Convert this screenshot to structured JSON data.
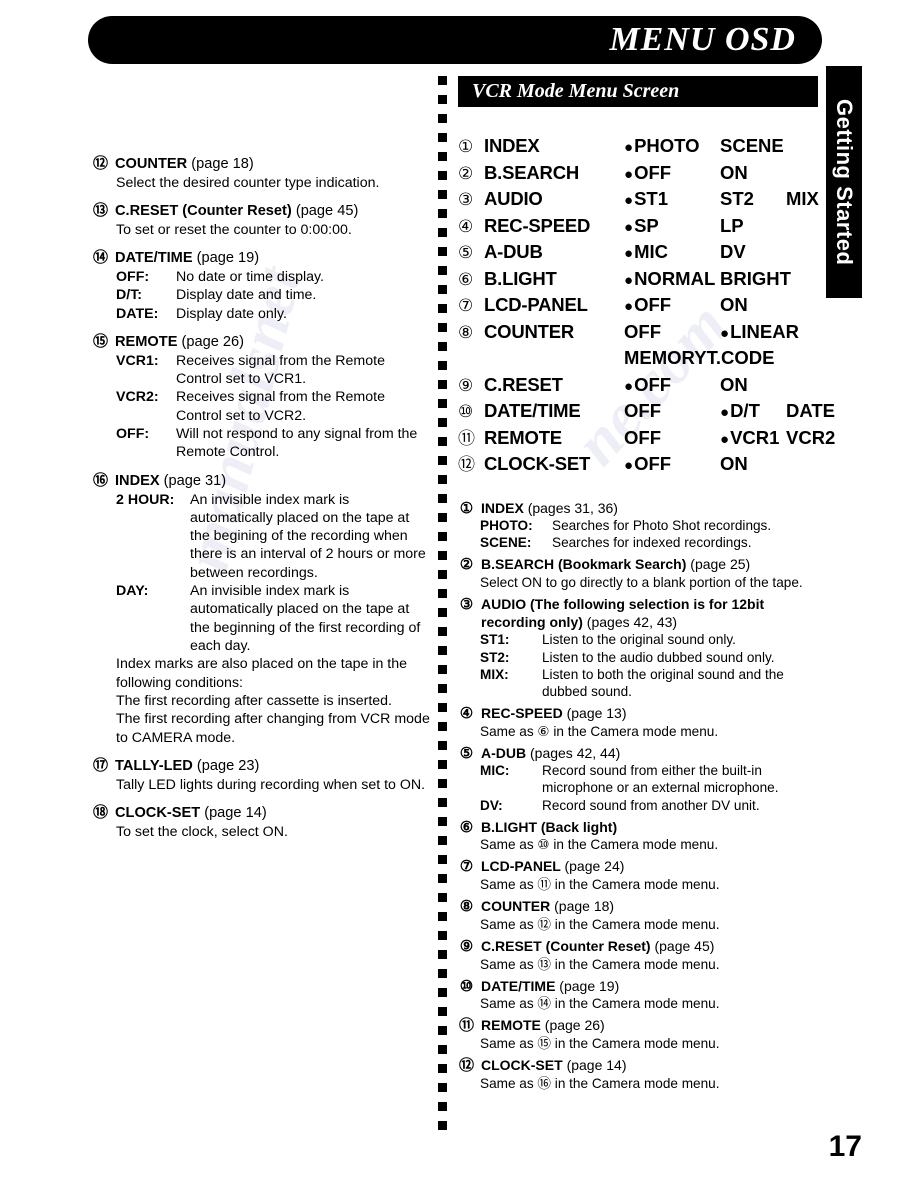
{
  "header": {
    "title": "MENU OSD",
    "side_tab": "Getting Started"
  },
  "page_number": "17",
  "left_column": {
    "entries": [
      {
        "num": "⑫",
        "label": "COUNTER",
        "page": "(page 18)",
        "desc": "Select the desired counter type indication."
      },
      {
        "num": "⑬",
        "label": "C.RESET (Counter Reset)",
        "page": "(page 45)",
        "desc": "To set or reset the counter to 0:00:00."
      },
      {
        "num": "⑭",
        "label": "DATE/TIME",
        "page": "(page 19)",
        "options": [
          {
            "key": "OFF:",
            "value": "No date or time display."
          },
          {
            "key": "D/T:",
            "value": "Display date and time."
          },
          {
            "key": "DATE:",
            "value": "Display date only."
          }
        ]
      },
      {
        "num": "⑮",
        "label": "REMOTE",
        "page": "(page 26)",
        "options": [
          {
            "key": "VCR1:",
            "value": "Receives signal from the Remote Control set to VCR1."
          },
          {
            "key": "VCR2:",
            "value": "Receives signal from the Remote Control set to VCR2."
          },
          {
            "key": "OFF:",
            "value": "Will not respond to any signal from the Remote Control."
          }
        ]
      },
      {
        "num": "⑯",
        "label": "INDEX",
        "page": "(page 31)",
        "options": [
          {
            "key": "2 HOUR:",
            "value": "An invisible index mark is automatically placed on the tape at the begining of the recording when there is an interval of 2 hours or more between recordings."
          },
          {
            "key": "DAY:",
            "value": "An invisible index mark is automatically placed on the tape at the beginning of the first recording of each day."
          }
        ],
        "extra": [
          "Index marks are also placed on the tape in the following conditions:",
          "The first recording after cassette is inserted.",
          "The first recording after changing from VCR mode to CAMERA mode."
        ]
      },
      {
        "num": "⑰",
        "label": "TALLY-LED",
        "page": "(page 23)",
        "desc": "Tally LED lights during recording when set to ON."
      },
      {
        "num": "⑱",
        "label": "CLOCK-SET",
        "page": "(page 14)",
        "desc": "To set the clock, select ON."
      }
    ]
  },
  "right_column": {
    "menu_screen_title": "VCR Mode Menu Screen",
    "osd_rows": [
      {
        "num": "①",
        "name": "INDEX",
        "opt1": "PHOTO",
        "opt1_selected": true,
        "opt2": "SCENE",
        "opt2_selected": false,
        "opt3": "",
        "opt3_selected": false
      },
      {
        "num": "②",
        "name": "B.SEARCH",
        "opt1": "OFF",
        "opt1_selected": true,
        "opt2": "ON",
        "opt2_selected": false,
        "opt3": "",
        "opt3_selected": false
      },
      {
        "num": "③",
        "name": "AUDIO",
        "opt1": "ST1",
        "opt1_selected": true,
        "opt2": "ST2",
        "opt2_selected": false,
        "opt3": "MIX",
        "opt3_selected": false
      },
      {
        "num": "④",
        "name": "REC-SPEED",
        "opt1": "SP",
        "opt1_selected": true,
        "opt2": "LP",
        "opt2_selected": false,
        "opt3": "",
        "opt3_selected": false
      },
      {
        "num": "⑤",
        "name": "A-DUB",
        "opt1": "MIC",
        "opt1_selected": true,
        "opt2": "DV",
        "opt2_selected": false,
        "opt3": "",
        "opt3_selected": false
      },
      {
        "num": "⑥",
        "name": "B.LIGHT",
        "opt1": "NORMAL",
        "opt1_selected": true,
        "opt2": "BRIGHT",
        "opt2_selected": false,
        "opt3": "",
        "opt3_selected": false
      },
      {
        "num": "⑦",
        "name": "LCD-PANEL",
        "opt1": "OFF",
        "opt1_selected": true,
        "opt2": "ON",
        "opt2_selected": false,
        "opt3": "",
        "opt3_selected": false
      },
      {
        "num": "⑧",
        "name": "COUNTER",
        "opt1": "OFF",
        "opt1_selected": false,
        "opt2": "LINEAR",
        "opt2_selected": true,
        "opt3": "",
        "opt3_selected": false,
        "sub1": "MEMORY",
        "sub1_selected": false,
        "sub2": "T.CODE",
        "sub2_selected": false
      },
      {
        "num": "⑨",
        "name": "C.RESET",
        "opt1": "OFF",
        "opt1_selected": true,
        "opt2": "ON",
        "opt2_selected": false,
        "opt3": "",
        "opt3_selected": false
      },
      {
        "num": "⑩",
        "name": "DATE/TIME",
        "opt1": "OFF",
        "opt1_selected": false,
        "opt2": "D/T",
        "opt2_selected": true,
        "opt3": "DATE",
        "opt3_selected": false
      },
      {
        "num": "⑪",
        "name": "REMOTE",
        "opt1": "OFF",
        "opt1_selected": false,
        "opt2": "VCR1",
        "opt2_selected": true,
        "opt3": "VCR2",
        "opt3_selected": false
      },
      {
        "num": "⑫",
        "name": "CLOCK-SET",
        "opt1": "OFF",
        "opt1_selected": true,
        "opt2": "ON",
        "opt2_selected": false,
        "opt3": "",
        "opt3_selected": false
      }
    ],
    "descriptions": [
      {
        "num": "①",
        "label": "INDEX",
        "page": "(pages 31, 36)",
        "options": [
          {
            "key": "PHOTO:",
            "value": "Searches for Photo Shot recordings."
          },
          {
            "key": "SCENE:",
            "value": "Searches for indexed recordings."
          }
        ]
      },
      {
        "num": "②",
        "label": "B.SEARCH (Bookmark Search)",
        "page": "(page 25)",
        "desc": "Select ON to go directly to a blank portion of the tape."
      },
      {
        "num": "③",
        "label": "AUDIO (The following selection is for 12bit recording only)",
        "page": "(pages 42, 43)",
        "options": [
          {
            "key": "ST1:",
            "value": "Listen to the original sound only."
          },
          {
            "key": "ST2:",
            "value": "Listen to the audio dubbed sound only."
          },
          {
            "key": "MIX:",
            "value": "Listen to both the original sound and the dubbed sound."
          }
        ]
      },
      {
        "num": "④",
        "label": "REC-SPEED",
        "page": "(page 13)",
        "sameas_pre": "Same as",
        "sameas_num": "⑥",
        "sameas_post": "in the Camera mode menu."
      },
      {
        "num": "⑤",
        "label": "A-DUB",
        "page": "(pages 42, 44)",
        "options": [
          {
            "key": "MIC:",
            "value": "Record sound from either the built-in microphone or an external microphone."
          },
          {
            "key": "DV:",
            "value": "Record sound from another DV unit."
          }
        ]
      },
      {
        "num": "⑥",
        "label": "B.LIGHT (Back light)",
        "page": "",
        "sameas_pre": "Same as",
        "sameas_num": "⑩",
        "sameas_post": "in the Camera mode menu."
      },
      {
        "num": "⑦",
        "label": "LCD-PANEL",
        "page": "(page 24)",
        "sameas_pre": "Same as",
        "sameas_num": "⑪",
        "sameas_post": "in the Camera mode menu."
      },
      {
        "num": "⑧",
        "label": "COUNTER",
        "page": "(page 18)",
        "sameas_pre": "Same as",
        "sameas_num": "⑫",
        "sameas_post": "in the Camera mode menu."
      },
      {
        "num": "⑨",
        "label": "C.RESET (Counter Reset)",
        "page": "(page 45)",
        "sameas_pre": "Same as",
        "sameas_num": "⑬",
        "sameas_post": "in the Camera mode menu."
      },
      {
        "num": "⑩",
        "label": "DATE/TIME",
        "page": "(page 19)",
        "sameas_pre": "Same as",
        "sameas_num": "⑭",
        "sameas_post": "in the Camera mode menu."
      },
      {
        "num": "⑪",
        "label": "REMOTE",
        "page": "(page 26)",
        "sameas_pre": "Same as",
        "sameas_num": "⑮",
        "sameas_post": "in the Camera mode menu."
      },
      {
        "num": "⑫",
        "label": "CLOCK-SET",
        "page": "(page 14)",
        "sameas_pre": "Same as",
        "sameas_num": "⑯",
        "sameas_post": "in the Camera mode menu."
      }
    ]
  },
  "watermark": {
    "text1": "manualsnet",
    "text2": "ne.com"
  }
}
